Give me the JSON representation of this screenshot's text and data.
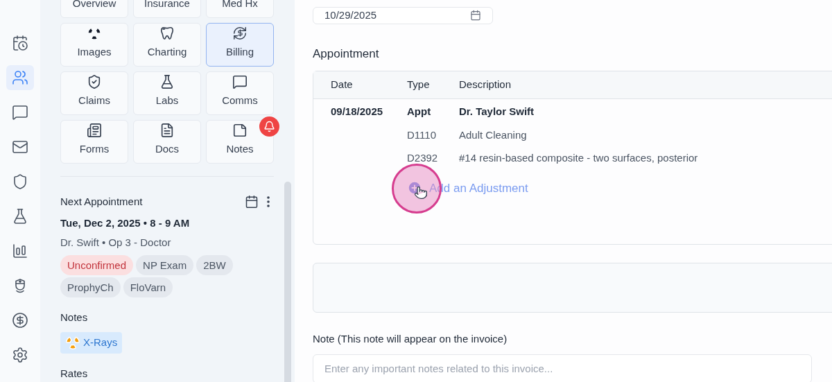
{
  "rail": [
    {
      "selected": false
    },
    {
      "selected": true
    },
    {
      "selected": false
    },
    {
      "selected": false
    },
    {
      "selected": false
    },
    {
      "selected": false
    },
    {
      "selected": false
    },
    {
      "selected": false
    },
    {
      "selected": false
    },
    {
      "selected": false
    }
  ],
  "tiles": [
    {
      "label": "Overview",
      "selected": false
    },
    {
      "label": "Insurance",
      "selected": false
    },
    {
      "label": "Med Hx",
      "selected": false
    },
    {
      "label": "Images",
      "selected": false,
      "alert": false
    },
    {
      "label": "Charting",
      "selected": false,
      "alert": false
    },
    {
      "label": "Billing",
      "selected": true,
      "alert": false
    },
    {
      "label": "Claims",
      "selected": false,
      "alert": false
    },
    {
      "label": "Labs",
      "selected": false,
      "alert": false
    },
    {
      "label": "Comms",
      "selected": false,
      "alert": false
    },
    {
      "label": "Forms",
      "selected": false,
      "alert": false
    },
    {
      "label": "Docs",
      "selected": false,
      "alert": false
    },
    {
      "label": "Notes",
      "selected": false,
      "alert": true
    }
  ],
  "next_appointment": {
    "title": "Next Appointment",
    "datetime": "Tue, Dec 2, 2025 • 8 - 9 AM",
    "provider": "Dr. Swift • Op 3 - Doctor",
    "tags": [
      {
        "label": "Unconfirmed",
        "kind": "status"
      },
      {
        "label": "NP Exam",
        "kind": "procedure"
      },
      {
        "label": "2BW",
        "kind": "procedure"
      },
      {
        "label": "ProphyCh",
        "kind": "procedure"
      },
      {
        "label": "FloVarn",
        "kind": "procedure"
      }
    ]
  },
  "notes": {
    "title": "Notes",
    "tags": [
      {
        "label": "X-Rays"
      }
    ]
  },
  "rates": {
    "title": "Rates"
  },
  "date_field": {
    "value": "10/29/2025"
  },
  "appointment": {
    "title": "Appointment",
    "columns": [
      "Date",
      "Type",
      "Description"
    ],
    "rows": [
      {
        "kind": "appointment",
        "date": "09/18/2025",
        "type": "Appt",
        "description": "Dr. Taylor Swift"
      },
      {
        "kind": "procedure",
        "type": "D1110",
        "description": "Adult Cleaning"
      },
      {
        "kind": "procedure",
        "type": "D2392",
        "description": "#14 resin-based composite - two surfaces, posterior"
      }
    ],
    "add_adjustment": "Add an Adjustment"
  },
  "note": {
    "label": "Note (This note will appear on the invoice)",
    "placeholder": "Enter any important notes related to this invoice..."
  }
}
